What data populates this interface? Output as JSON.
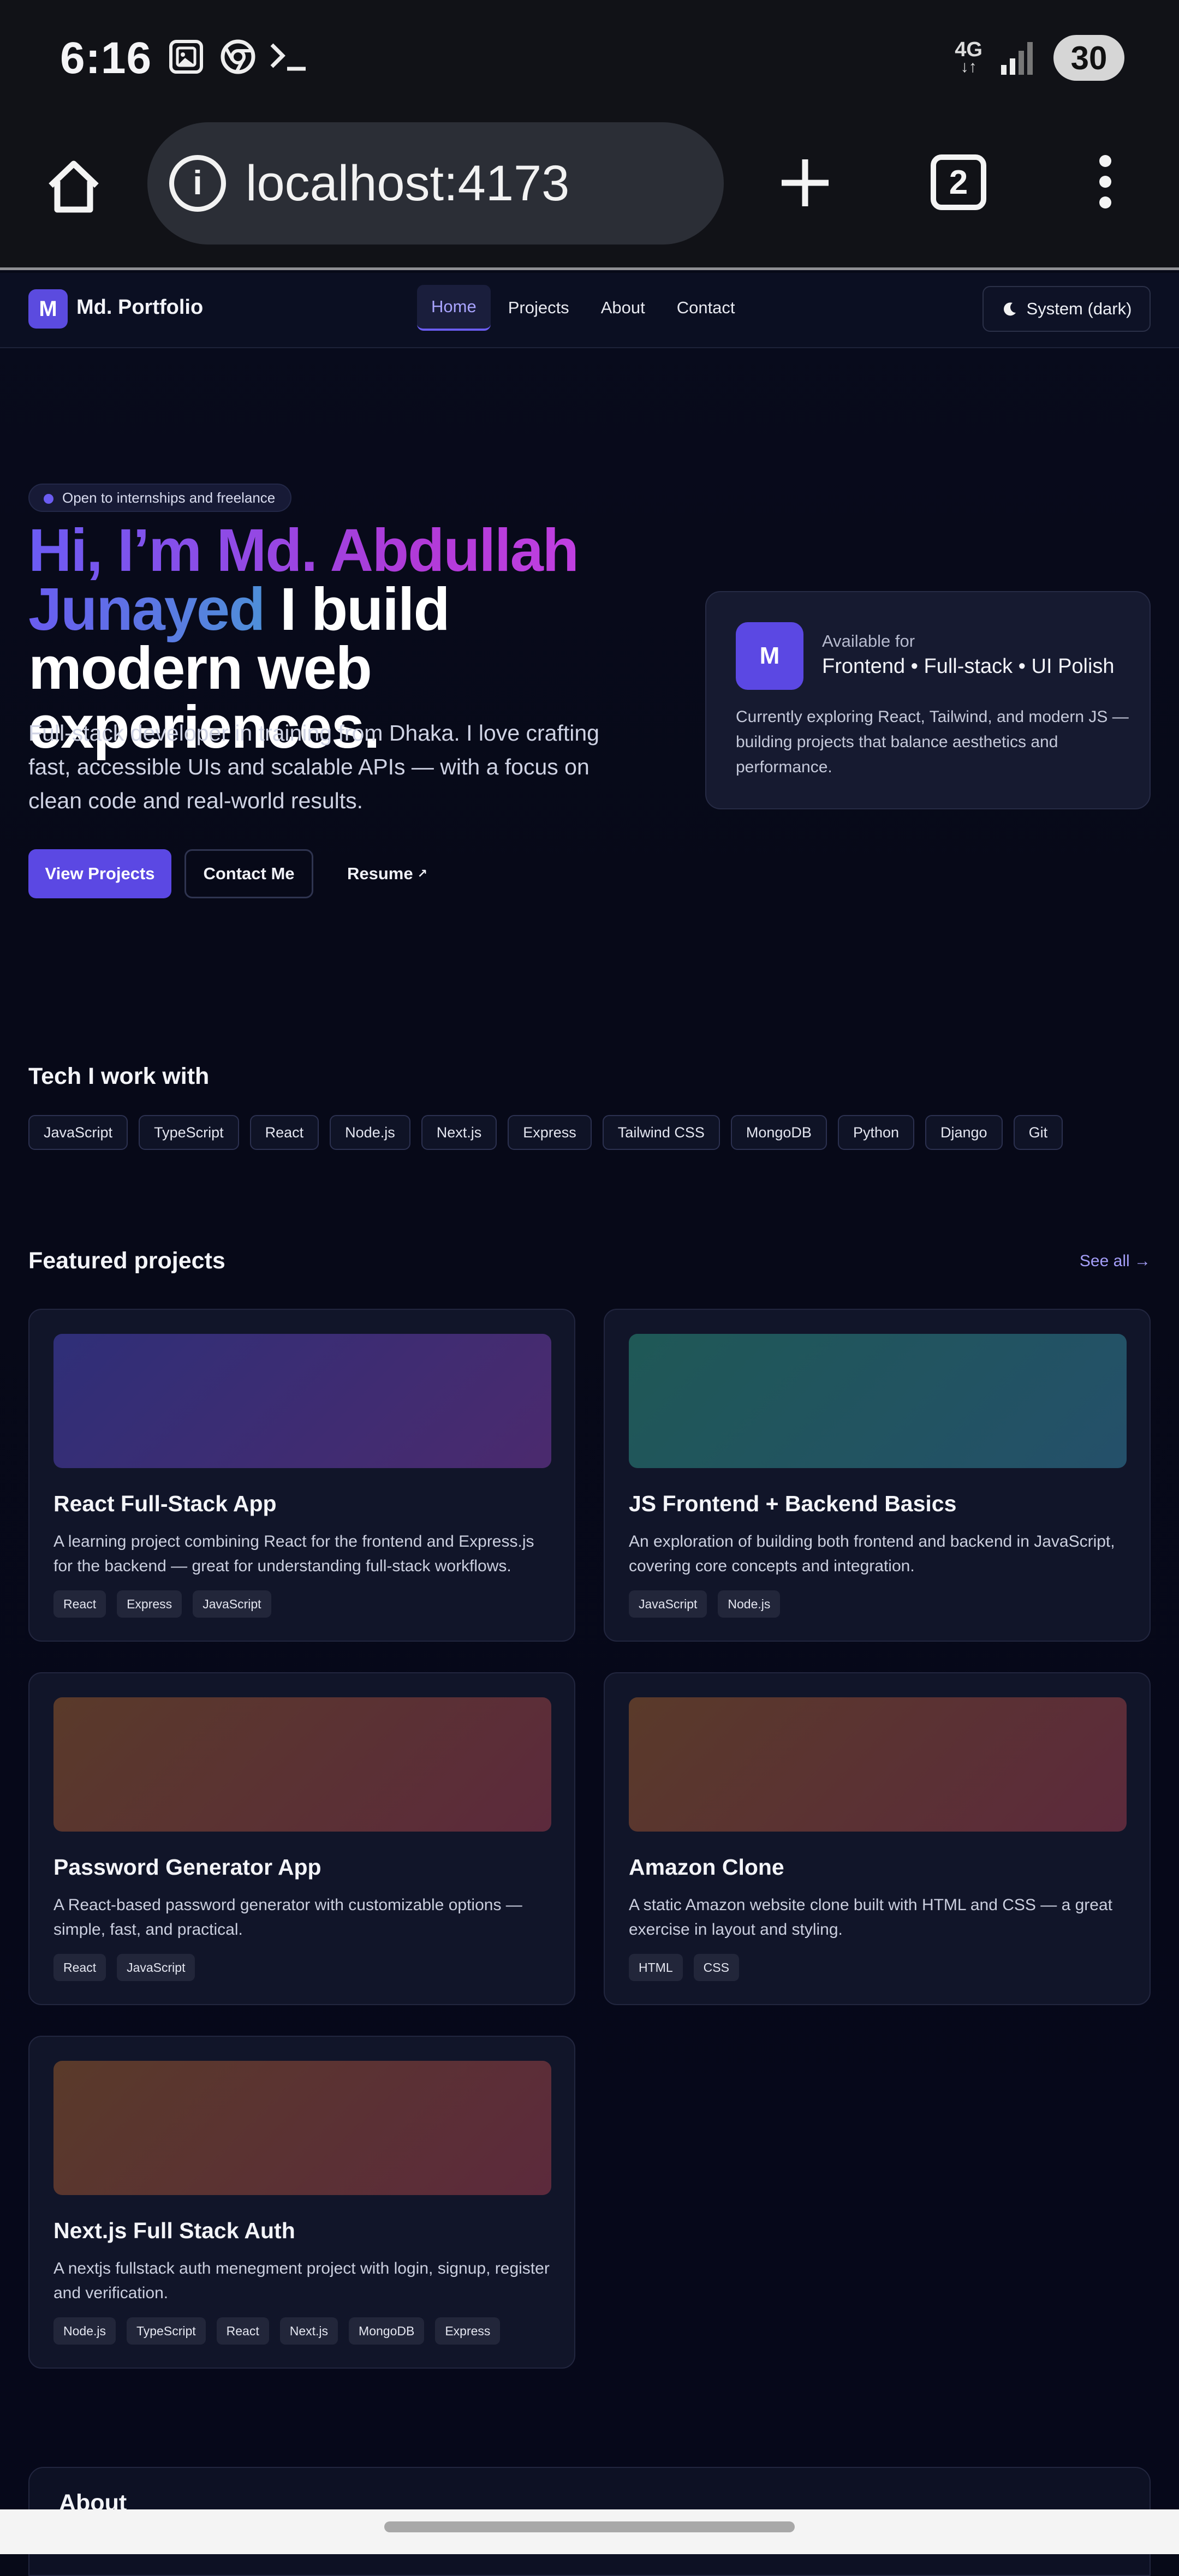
{
  "status_bar": {
    "time": "6:16",
    "network": "4G",
    "battery": "30",
    "icons": [
      "screenshot-icon",
      "chrome-icon",
      "terminal-icon",
      "signal-icon"
    ]
  },
  "browser": {
    "url": "localhost:4173",
    "tab_count": "2",
    "info_glyph": "i"
  },
  "navbar": {
    "logo_letter": "M",
    "logo_text": "Md. Portfolio",
    "links": [
      {
        "label": "Home",
        "active": true
      },
      {
        "label": "Projects",
        "active": false
      },
      {
        "label": "About",
        "active": false
      },
      {
        "label": "Contact",
        "active": false
      }
    ],
    "theme_label": "System (dark)"
  },
  "hero": {
    "badge": "Open to internships and freelance",
    "title_part1": "Hi, I’m Md. Abdullah",
    "title_part2": "Junayed",
    "title_part3": " I build modern web experiences.",
    "description": "Full-stack developer in training from Dhaka. I love crafting fast, accessible UIs and scalable APIs — with a focus on clean code and real-world results.",
    "btn_primary": "View Projects",
    "btn_outline": "Contact Me",
    "btn_link": "Resume",
    "btn_link_arrow": "↗"
  },
  "available_card": {
    "letter": "M",
    "label": "Available for",
    "value": "Frontend • Full-stack • UI Polish",
    "description": "Currently exploring React, Tailwind, and modern JS — building projects that balance aesthetics and performance."
  },
  "tech": {
    "title": "Tech I work with",
    "items": [
      "JavaScript",
      "TypeScript",
      "React",
      "Node.js",
      "Next.js",
      "Express",
      "Tailwind CSS",
      "MongoDB",
      "Python",
      "Django",
      "Git"
    ]
  },
  "projects": {
    "title": "Featured projects",
    "see_all": "See all →",
    "items": [
      {
        "title": "React Full-Stack App",
        "description": "A learning project combining React for the frontend and Express.js for the backend — great for understanding full-stack workflows.",
        "tags": [
          "React",
          "Express",
          "JavaScript"
        ],
        "gradient": [
          "#2f2f78",
          "#4b2a6e"
        ]
      },
      {
        "title": "JS Frontend + Backend Basics",
        "description": "An exploration of building both frontend and backend in JavaScript, covering core concepts and integration.",
        "tags": [
          "JavaScript",
          "Node.js"
        ],
        "gradient": [
          "#1f5856",
          "#24506a"
        ]
      },
      {
        "title": "Password Generator App",
        "description": "A React-based password generator with customizable options — simple, fast, and practical.",
        "tags": [
          "React",
          "JavaScript"
        ],
        "gradient": [
          "#5a3a2a",
          "#5c2a3c"
        ]
      },
      {
        "title": "Amazon Clone",
        "description": "A static Amazon website clone built with HTML and CSS — a great exercise in layout and styling.",
        "tags": [
          "HTML",
          "CSS"
        ],
        "gradient": [
          "#5a3a2a",
          "#5c2a3c"
        ]
      },
      {
        "title": "Next.js Full Stack Auth",
        "description": "A nextjs fullstack auth menegment project with login, signup, register and verification.",
        "tags": [
          "Node.js",
          "TypeScript",
          "React",
          "Next.js",
          "MongoDB",
          "Express"
        ],
        "gradient": [
          "#5a3a2a",
          "#5c2a3c"
        ]
      }
    ]
  },
  "about": {
    "title": "About"
  },
  "colors": {
    "accent": "#5b48e3",
    "background": "#070a18",
    "card": "#111529"
  }
}
